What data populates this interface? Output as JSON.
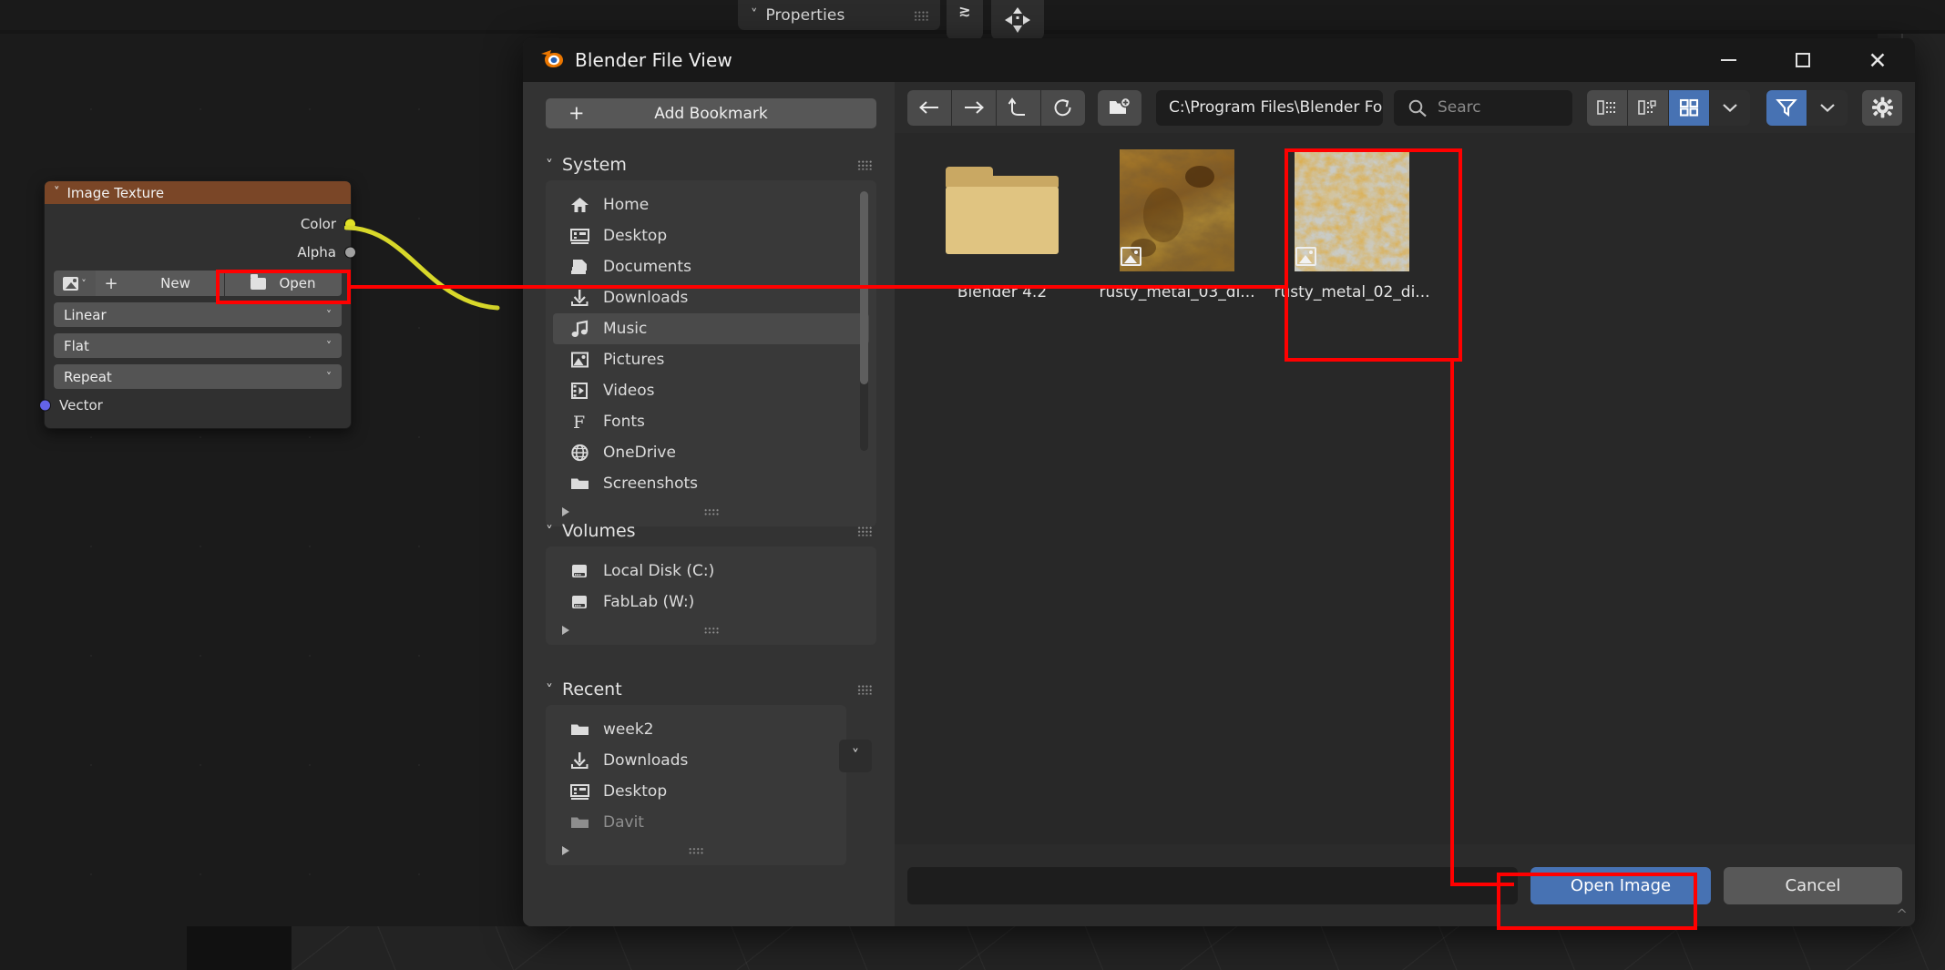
{
  "backdrop": {
    "properties_panel_label": "Properties",
    "node": {
      "title": "Image Texture",
      "outputs": [
        {
          "label": "Color",
          "color": "#e3e326"
        },
        {
          "label": "Alpha",
          "color": "#a0a0a0"
        }
      ],
      "image_row": {
        "new_label": "New",
        "open_label": "Open",
        "plus_label": "+"
      },
      "selects": [
        {
          "value": "Linear"
        },
        {
          "value": "Flat"
        },
        {
          "value": "Repeat"
        }
      ],
      "inputs": [
        {
          "label": "Vector",
          "color": "#6363e8"
        }
      ]
    }
  },
  "dialog": {
    "title": "Blender File View",
    "window_buttons": {
      "minimize": "minimize-icon",
      "maximize": "maximize-icon",
      "close": "close-icon"
    },
    "bookmarks": {
      "add_bookmark_label": "Add Bookmark",
      "sections": [
        {
          "title": "System",
          "items": [
            {
              "label": "Home",
              "icon": "home-icon",
              "selected": false
            },
            {
              "label": "Desktop",
              "icon": "desktop-icon",
              "selected": false
            },
            {
              "label": "Documents",
              "icon": "documents-icon",
              "selected": false
            },
            {
              "label": "Downloads",
              "icon": "download-icon",
              "selected": false
            },
            {
              "label": "Music",
              "icon": "music-icon",
              "selected": true
            },
            {
              "label": "Pictures",
              "icon": "picture-icon",
              "selected": false
            },
            {
              "label": "Videos",
              "icon": "video-icon",
              "selected": false
            },
            {
              "label": "Fonts",
              "icon": "font-icon",
              "selected": false
            },
            {
              "label": "OneDrive",
              "icon": "globe-icon",
              "selected": false
            },
            {
              "label": "Screenshots",
              "icon": "folder-icon",
              "selected": false
            }
          ]
        },
        {
          "title": "Volumes",
          "items": [
            {
              "label": "Local Disk (C:)",
              "icon": "disk-icon",
              "selected": false
            },
            {
              "label": "FabLab (W:)",
              "icon": "disk-icon",
              "selected": false
            }
          ]
        },
        {
          "title": "Recent",
          "items": [
            {
              "label": "week2",
              "icon": "folder-icon",
              "selected": false,
              "dim": false
            },
            {
              "label": "Downloads",
              "icon": "download-icon",
              "selected": false,
              "dim": false
            },
            {
              "label": "Desktop",
              "icon": "desktop-icon",
              "selected": false,
              "dim": false
            },
            {
              "label": "Davit",
              "icon": "folder-icon",
              "selected": false,
              "dim": true
            }
          ]
        }
      ]
    },
    "toolbar": {
      "back_icon": "arrow-left-icon",
      "forward_icon": "arrow-right-icon",
      "up_icon": "arrow-up-parent-icon",
      "refresh_icon": "refresh-icon",
      "new_folder_icon": "new-folder-icon",
      "path_value": "C:\\Program Files\\Blender Foundation\\",
      "search_placeholder": "Searc",
      "display_modes": [
        {
          "icon": "list-vertical-icon",
          "active": false
        },
        {
          "icon": "list-detail-icon",
          "active": false
        },
        {
          "icon": "thumbnail-grid-icon",
          "active": true
        },
        {
          "icon": "chevron-down-icon",
          "active": false
        }
      ],
      "filter_icon": "funnel-icon",
      "filter_active": true,
      "filter_chevron_icon": "chevron-down-icon",
      "settings_icon": "gear-icon"
    },
    "files": [
      {
        "name": "Blender 4.2",
        "type": "folder",
        "selected": false
      },
      {
        "name": "rusty_metal_03_di...",
        "type": "image",
        "selected": false
      },
      {
        "name": "rusty_metal_02_di...",
        "type": "image",
        "selected": true
      }
    ],
    "footer": {
      "filename_value": "",
      "confirm_label": "Open Image",
      "cancel_label": "Cancel"
    }
  },
  "annotations": {
    "accent_color": "#ff0000",
    "highlight_open_button": true,
    "highlight_selected_file": true,
    "highlight_confirm_button": true
  }
}
